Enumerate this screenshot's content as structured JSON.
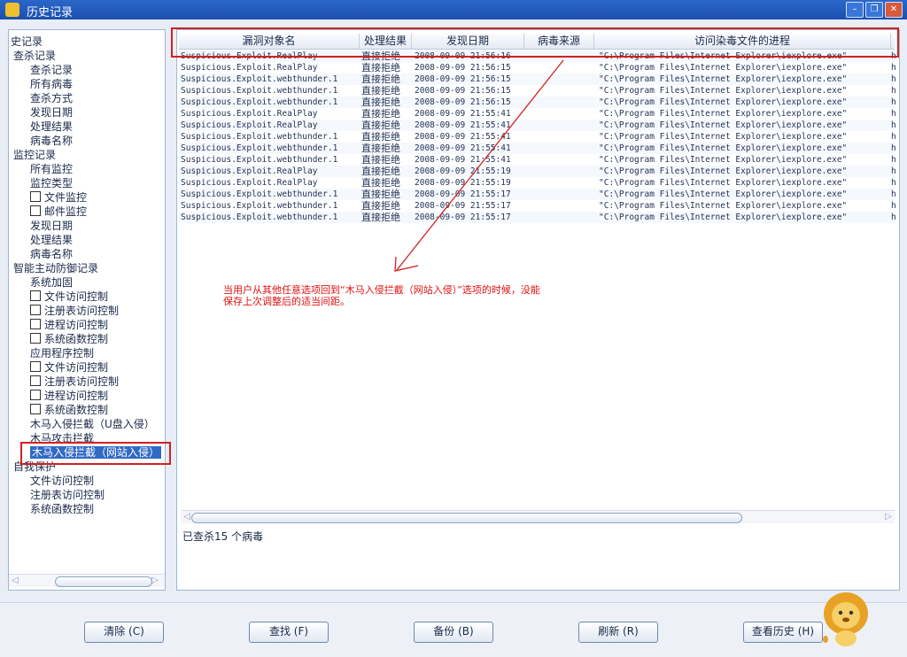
{
  "window": {
    "title": "历史记录",
    "minimize": "–",
    "restore": "❐",
    "close": "✕"
  },
  "tree": {
    "items": [
      {
        "label": "史记录",
        "indent": 0,
        "icon": false
      },
      {
        "label": "查杀记录",
        "indent": 1,
        "icon": false
      },
      {
        "label": "查杀记录",
        "indent": 2,
        "icon": false
      },
      {
        "label": "所有病毒",
        "indent": 2,
        "icon": false
      },
      {
        "label": "查杀方式",
        "indent": 2,
        "icon": false
      },
      {
        "label": "发现日期",
        "indent": 2,
        "icon": false
      },
      {
        "label": "处理结果",
        "indent": 2,
        "icon": false
      },
      {
        "label": "病毒名称",
        "indent": 2,
        "icon": false
      },
      {
        "label": "监控记录",
        "indent": 1,
        "icon": false
      },
      {
        "label": "所有监控",
        "indent": 2,
        "icon": false
      },
      {
        "label": "监控类型",
        "indent": 2,
        "icon": false
      },
      {
        "label": "文件监控",
        "indent": 3,
        "icon": true
      },
      {
        "label": "邮件监控",
        "indent": 3,
        "icon": true
      },
      {
        "label": "发现日期",
        "indent": 2,
        "icon": false
      },
      {
        "label": "处理结果",
        "indent": 2,
        "icon": false
      },
      {
        "label": "病毒名称",
        "indent": 2,
        "icon": false
      },
      {
        "label": "智能主动防御记录",
        "indent": 1,
        "icon": false
      },
      {
        "label": "系统加固",
        "indent": 2,
        "icon": false
      },
      {
        "label": "文件访问控制",
        "indent": 3,
        "icon": true
      },
      {
        "label": "注册表访问控制",
        "indent": 3,
        "icon": true
      },
      {
        "label": "进程访问控制",
        "indent": 3,
        "icon": true
      },
      {
        "label": "系统函数控制",
        "indent": 3,
        "icon": true
      },
      {
        "label": "应用程序控制",
        "indent": 2,
        "icon": false
      },
      {
        "label": "文件访问控制",
        "indent": 3,
        "icon": true
      },
      {
        "label": "注册表访问控制",
        "indent": 3,
        "icon": true
      },
      {
        "label": "进程访问控制",
        "indent": 3,
        "icon": true
      },
      {
        "label": "系统函数控制",
        "indent": 3,
        "icon": true
      },
      {
        "label": "木马入侵拦截（U盘入侵）",
        "indent": 2,
        "icon": false
      },
      {
        "label": "木马攻击拦截",
        "indent": 2,
        "icon": false
      },
      {
        "label": "木马入侵拦截（网站入侵）",
        "indent": 2,
        "icon": false,
        "selected": true
      },
      {
        "label": "自我保护",
        "indent": 1,
        "icon": false
      },
      {
        "label": "文件访问控制",
        "indent": 2,
        "icon": false
      },
      {
        "label": "注册表访问控制",
        "indent": 2,
        "icon": false
      },
      {
        "label": "系统函数控制",
        "indent": 2,
        "icon": false
      }
    ]
  },
  "table": {
    "columns": [
      "漏洞对象名",
      "处理结果",
      "发现日期",
      "病毒来源",
      "访问染毒文件的进程"
    ],
    "rows": [
      {
        "name": "Suspicious.Exploit.RealPlay",
        "result": "直接拒绝",
        "date": "2008-09-09 21:56:16",
        "source": "",
        "process": "\"C:\\Program Files\\Internet Explorer\\iexplore.exe\""
      },
      {
        "name": "Suspicious.Exploit.RealPlay",
        "result": "直接拒绝",
        "date": "2008-09-09 21:56:15",
        "source": "",
        "process": "\"C:\\Program Files\\Internet Explorer\\iexplore.exe\""
      },
      {
        "name": "Suspicious.Exploit.webthunder.1",
        "result": "直接拒绝",
        "date": "2008-09-09 21:56:15",
        "source": "",
        "process": "\"C:\\Program Files\\Internet Explorer\\iexplore.exe\""
      },
      {
        "name": "Suspicious.Exploit.webthunder.1",
        "result": "直接拒绝",
        "date": "2008-09-09 21:56:15",
        "source": "",
        "process": "\"C:\\Program Files\\Internet Explorer\\iexplore.exe\""
      },
      {
        "name": "Suspicious.Exploit.webthunder.1",
        "result": "直接拒绝",
        "date": "2008-09-09 21:56:15",
        "source": "",
        "process": "\"C:\\Program Files\\Internet Explorer\\iexplore.exe\""
      },
      {
        "name": "Suspicious.Exploit.RealPlay",
        "result": "直接拒绝",
        "date": "2008-09-09 21:55:41",
        "source": "",
        "process": "\"C:\\Program Files\\Internet Explorer\\iexplore.exe\""
      },
      {
        "name": "Suspicious.Exploit.RealPlay",
        "result": "直接拒绝",
        "date": "2008-09-09 21:55:41",
        "source": "",
        "process": "\"C:\\Program Files\\Internet Explorer\\iexplore.exe\""
      },
      {
        "name": "Suspicious.Exploit.webthunder.1",
        "result": "直接拒绝",
        "date": "2008-09-09 21:55:41",
        "source": "",
        "process": "\"C:\\Program Files\\Internet Explorer\\iexplore.exe\""
      },
      {
        "name": "Suspicious.Exploit.webthunder.1",
        "result": "直接拒绝",
        "date": "2008-09-09 21:55:41",
        "source": "",
        "process": "\"C:\\Program Files\\Internet Explorer\\iexplore.exe\""
      },
      {
        "name": "Suspicious.Exploit.webthunder.1",
        "result": "直接拒绝",
        "date": "2008-09-09 21:55:41",
        "source": "",
        "process": "\"C:\\Program Files\\Internet Explorer\\iexplore.exe\""
      },
      {
        "name": "Suspicious.Exploit.RealPlay",
        "result": "直接拒绝",
        "date": "2008-09-09 21:55:19",
        "source": "",
        "process": "\"C:\\Program Files\\Internet Explorer\\iexplore.exe\""
      },
      {
        "name": "Suspicious.Exploit.RealPlay",
        "result": "直接拒绝",
        "date": "2008-09-09 21:55:19",
        "source": "",
        "process": "\"C:\\Program Files\\Internet Explorer\\iexplore.exe\""
      },
      {
        "name": "Suspicious.Exploit.webthunder.1",
        "result": "直接拒绝",
        "date": "2008-09-09 21:55:17",
        "source": "",
        "process": "\"C:\\Program Files\\Internet Explorer\\iexplore.exe\""
      },
      {
        "name": "Suspicious.Exploit.webthunder.1",
        "result": "直接拒绝",
        "date": "2008-09-09 21:55:17",
        "source": "",
        "process": "\"C:\\Program Files\\Internet Explorer\\iexplore.exe\""
      },
      {
        "name": "Suspicious.Exploit.webthunder.1",
        "result": "直接拒绝",
        "date": "2008-09-09 21:55:17",
        "source": "",
        "process": "\"C:\\Program Files\\Internet Explorer\\iexplore.exe\""
      }
    ],
    "trailing_mark": "h"
  },
  "annotation": {
    "line1": "当用户从其他任意选项回到“木马入侵拦截（网站入侵）”选项的时候，没能",
    "line2": "保存上次调整后的适当间距。"
  },
  "status": {
    "text": "已查杀15 个病毒"
  },
  "buttons": {
    "clear": "清除 (C)",
    "find": "查找 (F)",
    "backup": "备份 (B)",
    "refresh": "刷新 (R)",
    "history": "查看历史 (H)"
  },
  "colors": {
    "annotation_red": "#d32020",
    "selection_blue": "#316ac5"
  }
}
